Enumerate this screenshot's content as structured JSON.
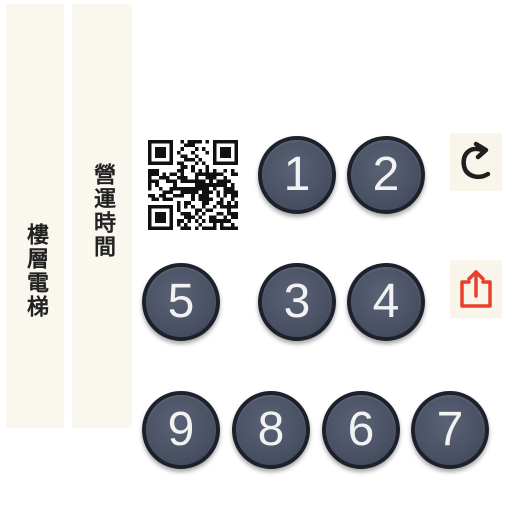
{
  "panels": {
    "floor_label": "樓層電梯",
    "hours_label": "營運時間"
  },
  "qr": {
    "icon": "qr-code-icon"
  },
  "keypad": {
    "keys": [
      "1",
      "2",
      "5",
      "3",
      "4",
      "9",
      "8",
      "6",
      "7"
    ]
  },
  "actions": {
    "refresh_icon": "refresh-arrow-icon",
    "share_icon": "share-upload-icon"
  },
  "colors": {
    "panel_bg": "#faf7ee",
    "key_fill": "#4a5164",
    "key_border": "#1d212b",
    "share_red": "#e8402a"
  }
}
